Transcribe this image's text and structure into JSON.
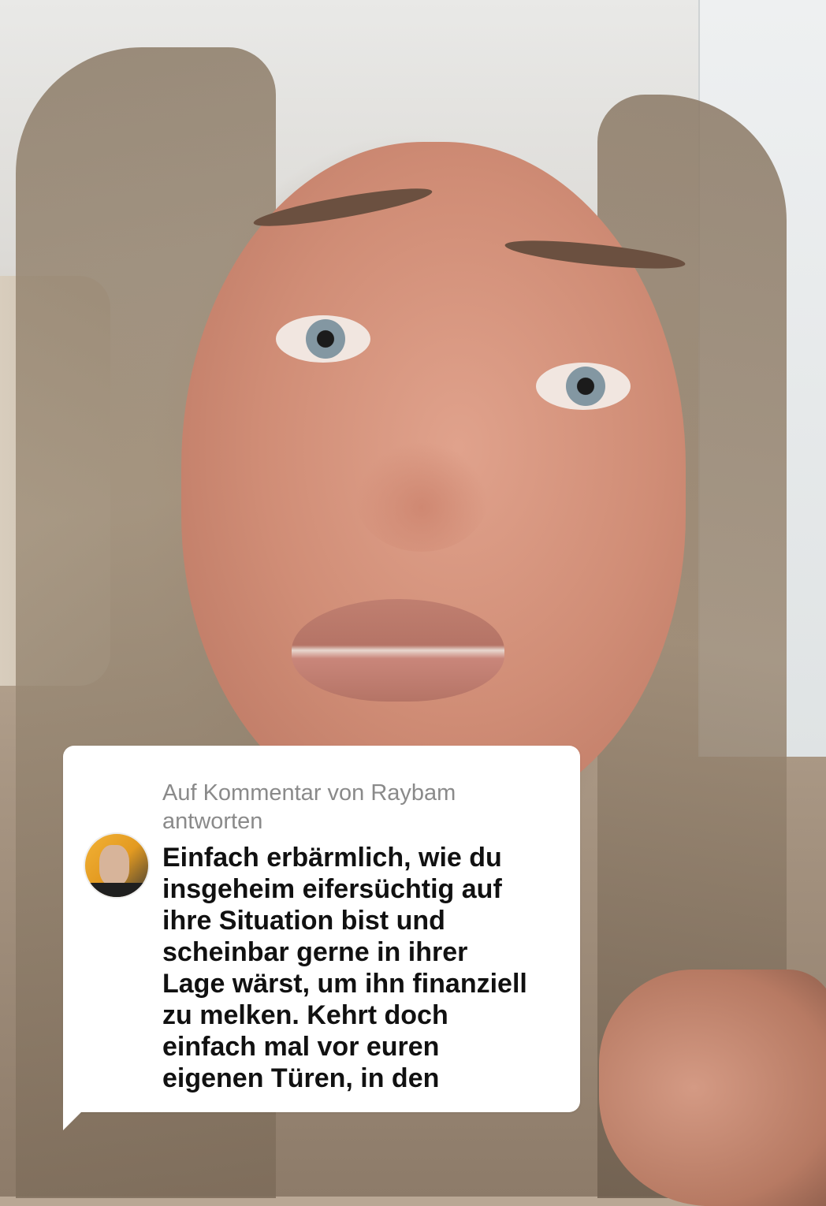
{
  "reply": {
    "header": "Auf Kommentar von Raybam antworten",
    "avatar_name": "avatar",
    "body": "Einfach erbärmlich, wie du\ninsgeheim eifersüchtig auf\nihre Situation bist und\nscheinbar gerne in ihrer\nLage wärst, um ihn finanziell\nzu melken. Kehrt doch\neinfach mal vor euren\neigenen Türen, in den"
  },
  "colors": {
    "card_bg": "#ffffff",
    "header_text": "#8a8a8a",
    "body_text": "#111111"
  }
}
